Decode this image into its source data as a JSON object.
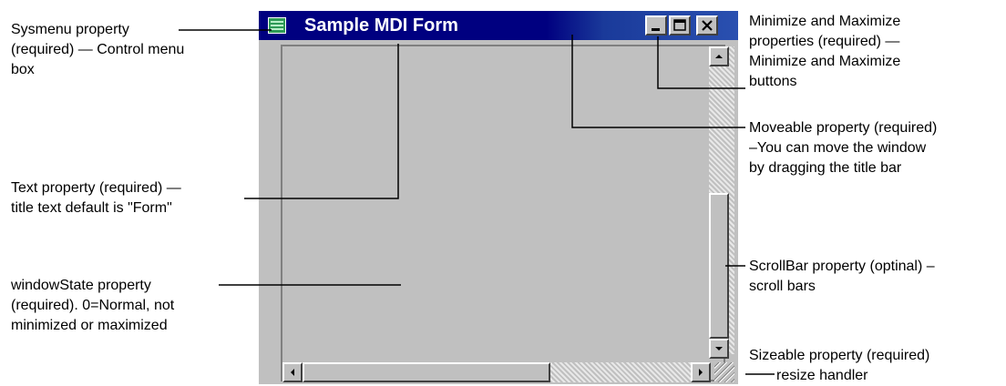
{
  "window": {
    "title": "Sample MDI Form",
    "icons": [
      "control-menu-icon",
      "minimize-icon",
      "maximize-icon",
      "close-icon",
      "scroll-up-arrow-icon",
      "scroll-down-arrow-icon",
      "scroll-left-arrow-icon",
      "scroll-right-arrow-icon",
      "resize-grip-icon"
    ]
  },
  "callouts": {
    "sysmenu": [
      "Sysmenu property",
      "(required) — Control menu",
      "box"
    ],
    "text": [
      "Text property (required) —",
      "title text default is \"Form\""
    ],
    "windowstate": [
      "windowState property",
      "(required). 0=Normal, not",
      "minimized or maximized"
    ],
    "minmax": [
      "Minimize and Maximize",
      "properties (required) —",
      "Minimize and Maximize",
      "buttons"
    ],
    "moveable": [
      "Moveable property (required)",
      "–You can move the window",
      "by dragging the title bar"
    ],
    "scrollbar": [
      "ScrollBar property (optinal) –",
      "scroll bars"
    ],
    "sizeable": [
      "Sizeable property (required)",
      "resize handler"
    ]
  }
}
